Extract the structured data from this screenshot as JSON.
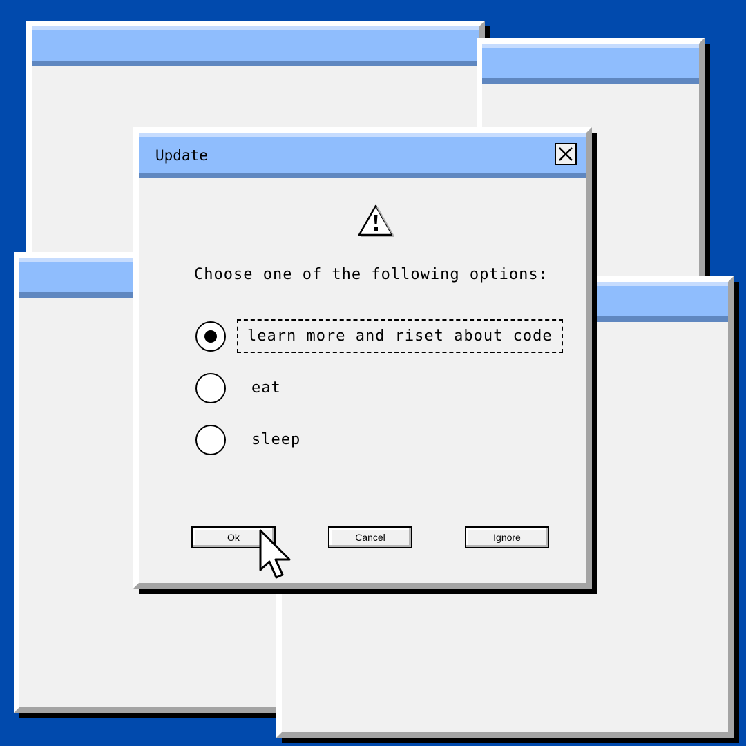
{
  "dialog": {
    "title": "Update",
    "prompt": "Choose one of the following options:",
    "options": [
      {
        "label": "learn more and riset about code",
        "selected": true
      },
      {
        "label": "eat",
        "selected": false
      },
      {
        "label": "sleep",
        "selected": false
      }
    ],
    "buttons": {
      "ok": "Ok",
      "cancel": "Cancel",
      "ignore": "Ignore"
    }
  },
  "icons": [
    "close-icon",
    "warning-icon",
    "mouse-pointer-icon"
  ],
  "colors": {
    "background": "#014aad",
    "titlebar": "#8fbdfd",
    "titlebar_shadow": "#5f87c0",
    "window": "#f1f1f1"
  }
}
